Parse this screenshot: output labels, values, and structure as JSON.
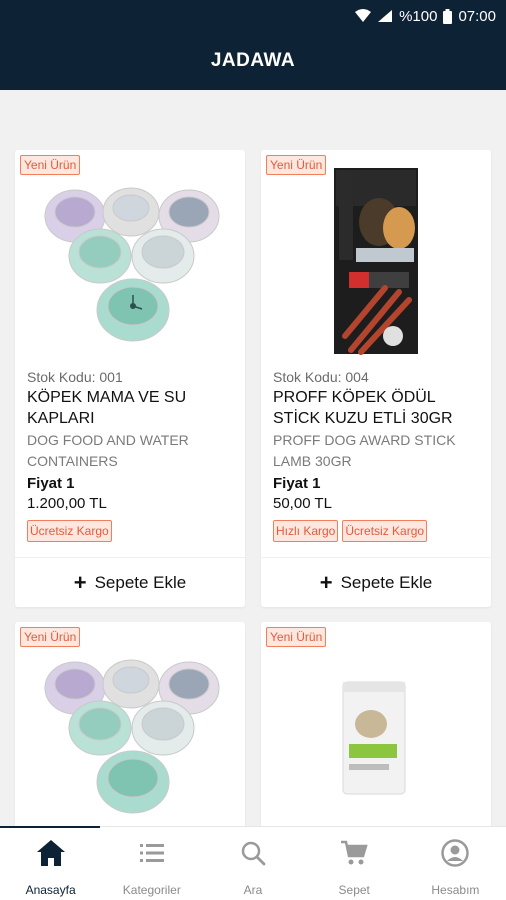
{
  "status_bar": {
    "battery": "%100",
    "time": "07:00"
  },
  "app_title": "JADAWA",
  "products": [
    {
      "badge": "Yeni Ürün",
      "stock_code": "Stok Kodu: 001",
      "title": "KÖPEK MAMA VE SU KAPLARI",
      "subtitle": "DOG FOOD AND WATER CONTAINERS",
      "price_label": "Fiyat 1",
      "price": "1.200,00 TL",
      "tags": [
        "Ücretsiz Kargo"
      ],
      "cart_label": "Sepete Ekle",
      "image": "pet-bowls"
    },
    {
      "badge": "Yeni Ürün",
      "stock_code": "Stok Kodu: 004",
      "title": "PROFF KÖPEK ÖDÜL STİCK KUZU ETLİ 30GR",
      "subtitle": "PROFF DOG AWARD STICK LAMB 30GR",
      "price_label": "Fiyat 1",
      "price": "50,00 TL",
      "tags": [
        "Hızlı Kargo",
        "Ücretsiz Kargo"
      ],
      "cart_label": "Sepete Ekle",
      "image": "proff-treat-package"
    },
    {
      "badge": "Yeni Ürün",
      "image": "pet-bowls"
    },
    {
      "badge": "Yeni Ürün",
      "image": "pet-food-pouch"
    }
  ],
  "bottom_nav": [
    {
      "label": "Anasayfa",
      "icon": "home-icon",
      "active": true
    },
    {
      "label": "Kategoriler",
      "icon": "list-icon",
      "active": false
    },
    {
      "label": "Ara",
      "icon": "search-icon",
      "active": false
    },
    {
      "label": "Sepet",
      "icon": "cart-icon",
      "active": false
    },
    {
      "label": "Hesabım",
      "icon": "account-icon",
      "active": false
    }
  ],
  "colors": {
    "primary": "#0e2235",
    "badge": "#e65a3b",
    "badge_bg": "#fde7df"
  }
}
